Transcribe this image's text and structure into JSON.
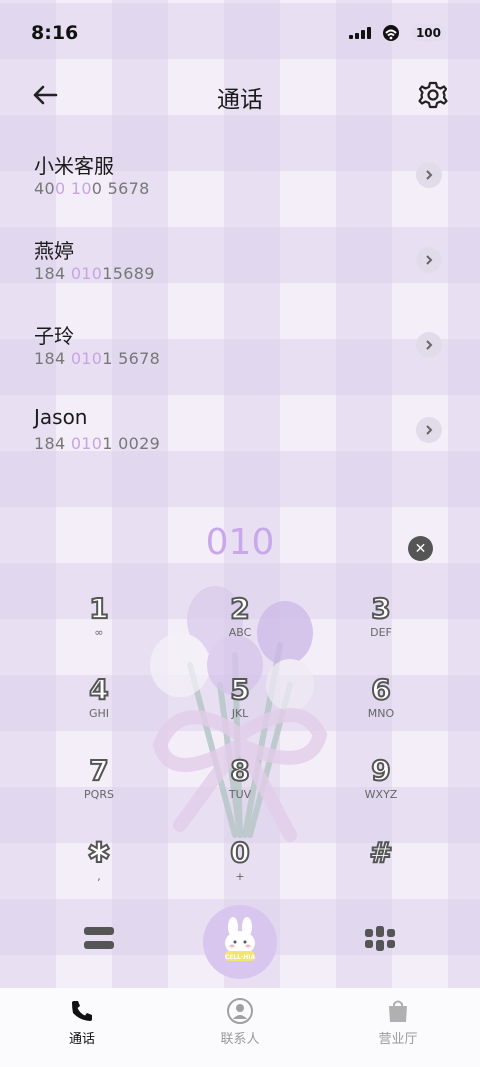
{
  "status_bar": {
    "time": "8:16",
    "battery": "100"
  },
  "header": {
    "title": "通话"
  },
  "contacts": [
    {
      "name": "小米客服",
      "number_parts": [
        "40",
        "0 10",
        "0 5678"
      ]
    },
    {
      "name": "燕婷",
      "number_parts": [
        "184 ",
        "010",
        "15689"
      ]
    },
    {
      "name": "子玲",
      "number_parts": [
        "184 ",
        "010",
        "1 5678"
      ]
    },
    {
      "name": "Jason",
      "number_parts": [
        "184 ",
        "010",
        "1 0029"
      ]
    }
  ],
  "dialer": {
    "input": "010",
    "keys": [
      {
        "digit": "1",
        "letters": "∞"
      },
      {
        "digit": "2",
        "letters": "ABC"
      },
      {
        "digit": "3",
        "letters": "DEF"
      },
      {
        "digit": "4",
        "letters": "GHI"
      },
      {
        "digit": "5",
        "letters": "JKL"
      },
      {
        "digit": "6",
        "letters": "MNO"
      },
      {
        "digit": "7",
        "letters": "PQRS"
      },
      {
        "digit": "8",
        "letters": "TUV"
      },
      {
        "digit": "9",
        "letters": "WXYZ"
      },
      {
        "digit": "✱",
        "letters": ","
      },
      {
        "digit": "0",
        "letters": "+"
      },
      {
        "digit": "#",
        "letters": ""
      }
    ],
    "call_button_badge": "CELL·HIA"
  },
  "tabs": [
    {
      "label": "通话",
      "icon": "phone-icon",
      "active": true
    },
    {
      "label": "联系人",
      "icon": "person-icon",
      "active": false
    },
    {
      "label": "营业厅",
      "icon": "bag-icon",
      "active": false
    }
  ],
  "colors": {
    "accent": "#c7a5e4",
    "background": "#f3eef8",
    "active_tab": "#111111",
    "inactive_tab": "#9a9a9a"
  }
}
